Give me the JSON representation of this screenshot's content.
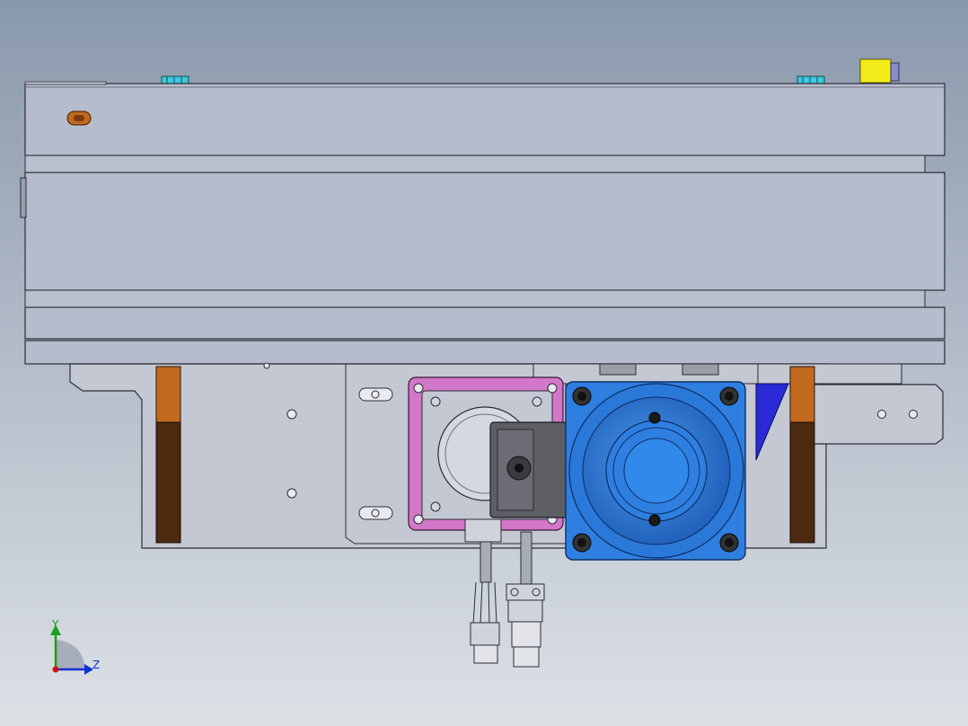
{
  "colors": {
    "background_top": "#8a98ac",
    "background_bottom": "#dde1e6",
    "plate": "#b6bccb",
    "plate_edge": "#2a2d36",
    "lower_plate": "#c4c8d3",
    "pink_flange": "#d377c9",
    "motor_blue": "#2f7fe0",
    "motor_dark_blue": "#1d5db8",
    "copper": "#c0691f",
    "dark_brown": "#4b2a10",
    "yellow": "#f2ec1a",
    "cyan": "#39c9e0",
    "bracket_gray": "#5e5f65",
    "axis_x": "#d01010",
    "axis_y": "#18a018",
    "axis_z": "#1030d0"
  },
  "triad": {
    "y_label": "Y",
    "z_label": "Z"
  }
}
